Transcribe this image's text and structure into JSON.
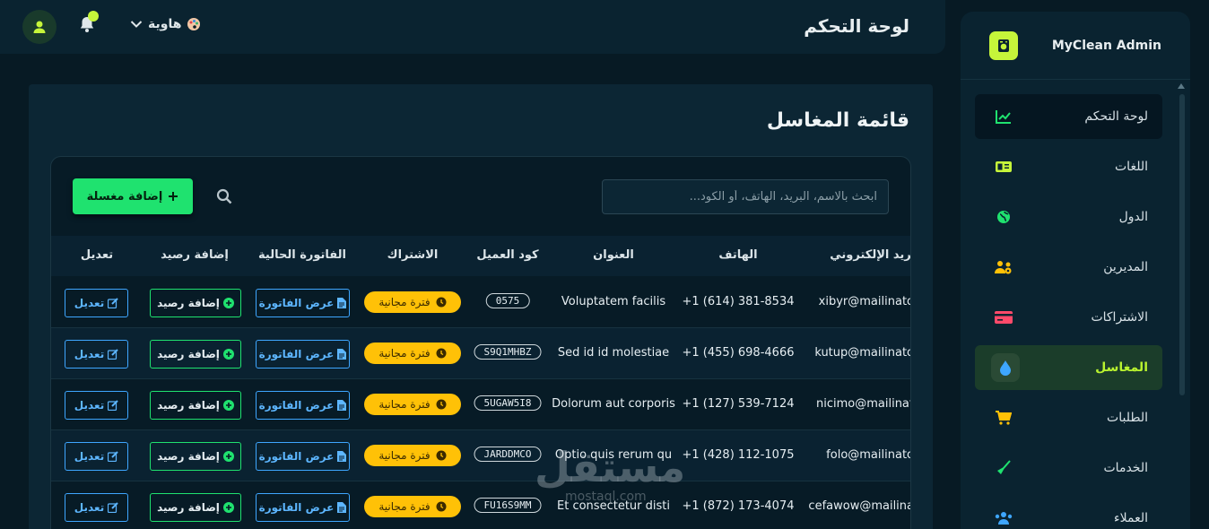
{
  "topbar": {
    "title": "لوحة التحكم",
    "hobby_label": "هاوية"
  },
  "sidebar": {
    "brand": "MyClean Admin",
    "items": [
      {
        "label": "لوحة التحكم",
        "icon": "chart-line-icon"
      },
      {
        "label": "اللغات",
        "icon": "language-icon"
      },
      {
        "label": "الدول",
        "icon": "globe-icon"
      },
      {
        "label": "المديرين",
        "icon": "users-cog-icon"
      },
      {
        "label": "الاشتراكات",
        "icon": "credit-card-icon"
      },
      {
        "label": "المغاسل",
        "icon": "water-drop-icon"
      },
      {
        "label": "الطلبات",
        "icon": "cart-icon"
      },
      {
        "label": "الخدمات",
        "icon": "broom-icon"
      },
      {
        "label": "العملاء",
        "icon": "users-icon"
      }
    ]
  },
  "page": {
    "title": "قائمة المغاسل",
    "add_button": "إضافة مغسلة",
    "search_placeholder": "ابحث بالاسم، البريد، الهاتف، أو الكود..."
  },
  "table": {
    "headers": {
      "email": "البريد الإلكتروني",
      "phone": "الهاتف",
      "address": "العنوان",
      "code": "كود العميل",
      "subscription": "الاشتراك",
      "invoice": "الفاتورة الحالية",
      "credit": "إضافة رصيد",
      "edit": "تعديل"
    },
    "rows": [
      {
        "email": "xibyr@mailinato",
        "phone": "+1 (614) 381-8534",
        "address": "Voluptatem facilis",
        "code": "0575",
        "subscription": "فترة مجانية",
        "invoice": "عرض الفاتورة",
        "credit": "إضافة رصيد",
        "edit": "تعديل"
      },
      {
        "email": "kutup@mailinato",
        "phone": "+1 (455) 698-4666",
        "address": "Sed id id molestiae",
        "code": "S9Q1MHBZ",
        "subscription": "فترة مجانية",
        "invoice": "عرض الفاتورة",
        "credit": "إضافة رصيد",
        "edit": "تعديل"
      },
      {
        "email": "nicimo@mailinat",
        "phone": "+1 (127) 539-7124",
        "address": "Dolorum aut corporis",
        "code": "5UGAW5I8",
        "subscription": "فترة مجانية",
        "invoice": "عرض الفاتورة",
        "credit": "إضافة رصيد",
        "edit": "تعديل"
      },
      {
        "email": "folo@mailinato",
        "phone": "+1 (428) 112-1075",
        "address": "Optio quis rerum qu",
        "code": "JARDDMCO",
        "subscription": "فترة مجانية",
        "invoice": "عرض الفاتورة",
        "credit": "إضافة رصيد",
        "edit": "تعديل"
      },
      {
        "email": "cefawow@mailina",
        "phone": "+1 (872) 173-4074",
        "address": "Et consectetur disti",
        "code": "FU16S9MM",
        "subscription": "فترة مجانية",
        "invoice": "عرض الفاتورة",
        "credit": "إضافة رصيد",
        "edit": "تعديل"
      }
    ]
  },
  "watermark": {
    "text": "مستقل",
    "sub": "mostaql.com"
  },
  "colors": {
    "accent": "#c6f53a",
    "success": "#1fe26f",
    "info": "#3ea6ff",
    "warning": "#ffc107"
  }
}
